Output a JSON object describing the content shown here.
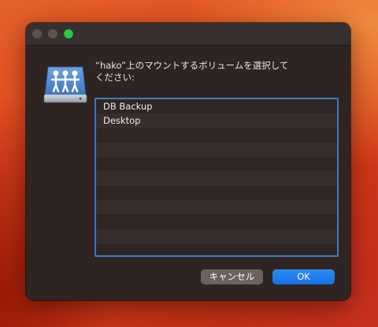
{
  "dialog": {
    "message_line1": "“hako”上のマウントするボリュームを選択して",
    "message_line2": "ください:",
    "icon": "shared-network-volume-icon",
    "accent_color": "#3e7bc0"
  },
  "volumes": {
    "items": [
      "DB Backup",
      "Desktop",
      "",
      "",
      "",
      "",
      "",
      "",
      "",
      "",
      ""
    ]
  },
  "buttons": {
    "cancel_label": "キャンセル",
    "ok_label": "OK",
    "ok_color": "#1f7ff0"
  }
}
